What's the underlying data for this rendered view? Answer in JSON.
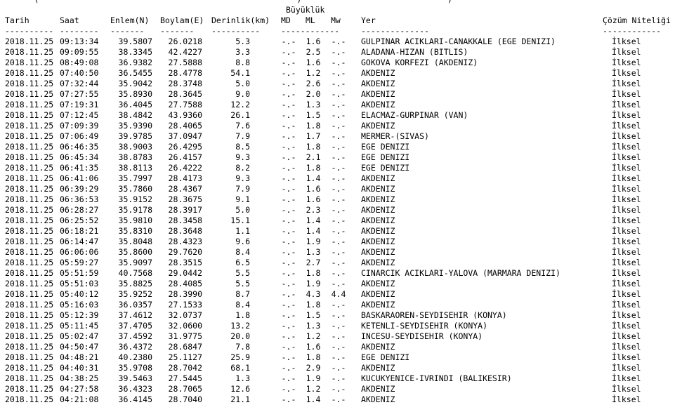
{
  "top_partial": "      (                                                     )                              )",
  "group_header": "Büyüklük",
  "headers": {
    "date": "Tarih",
    "time": "Saat",
    "lat": "Enlem(N)",
    "lon": "Boylam(E)",
    "depth": "Derinlik(km)",
    "md": "MD",
    "ml": "ML",
    "mw": "Mw",
    "location": "Yer",
    "solution": "Çözüm Niteliği"
  },
  "dashes": {
    "date": "----------",
    "time": "--------",
    "lat": "-------",
    "lon": "-------",
    "depth": "----------",
    "mag": "------------",
    "location": "--------------",
    "solution": "------------"
  },
  "rows": [
    [
      "2018.11.25",
      "09:13:34",
      "39.5807",
      "26.0218",
      "5.3",
      "-.-",
      "1.6",
      "-.-",
      "GULPINAR ACIKLARI-CANAKKALE (EGE DENIZI)",
      "İlksel"
    ],
    [
      "2018.11.25",
      "09:09:55",
      "38.3345",
      "42.4227",
      "3.3",
      "-.-",
      "2.5",
      "-.-",
      "ALADANA-HIZAN (BITLIS)",
      "İlksel"
    ],
    [
      "2018.11.25",
      "08:49:08",
      "36.9382",
      "27.5888",
      "8.8",
      "-.-",
      "1.6",
      "-.-",
      "GOKOVA KORFEZI (AKDENIZ)",
      "İlksel"
    ],
    [
      "2018.11.25",
      "07:40:50",
      "36.5455",
      "28.4778",
      "54.1",
      "-.-",
      "1.2",
      "-.-",
      "AKDENIZ",
      "İlksel"
    ],
    [
      "2018.11.25",
      "07:32:44",
      "35.9042",
      "28.3748",
      "5.0",
      "-.-",
      "2.6",
      "-.-",
      "AKDENIZ",
      "İlksel"
    ],
    [
      "2018.11.25",
      "07:27:55",
      "35.8930",
      "28.3645",
      "9.0",
      "-.-",
      "2.0",
      "-.-",
      "AKDENIZ",
      "İlksel"
    ],
    [
      "2018.11.25",
      "07:19:31",
      "36.4045",
      "27.7588",
      "12.2",
      "-.-",
      "1.3",
      "-.-",
      "AKDENIZ",
      "İlksel"
    ],
    [
      "2018.11.25",
      "07:12:45",
      "38.4842",
      "43.9360",
      "26.1",
      "-.-",
      "1.5",
      "-.-",
      "ELACMAZ-GURPINAR (VAN)",
      "İlksel"
    ],
    [
      "2018.11.25",
      "07:09:39",
      "35.9390",
      "28.4065",
      "7.6",
      "-.-",
      "1.8",
      "-.-",
      "AKDENIZ",
      "İlksel"
    ],
    [
      "2018.11.25",
      "07:06:49",
      "39.9785",
      "37.0947",
      "7.9",
      "-.-",
      "1.7",
      "-.-",
      "MERMER-(SIVAS)",
      "İlksel"
    ],
    [
      "2018.11.25",
      "06:46:35",
      "38.9003",
      "26.4295",
      "8.5",
      "-.-",
      "1.8",
      "-.-",
      "EGE DENIZI",
      "İlksel"
    ],
    [
      "2018.11.25",
      "06:45:34",
      "38.8783",
      "26.4157",
      "9.3",
      "-.-",
      "2.1",
      "-.-",
      "EGE DENIZI",
      "İlksel"
    ],
    [
      "2018.11.25",
      "06:41:35",
      "38.8113",
      "26.4222",
      "8.2",
      "-.-",
      "1.8",
      "-.-",
      "EGE DENIZI",
      "İlksel"
    ],
    [
      "2018.11.25",
      "06:41:06",
      "35.7997",
      "28.4173",
      "9.3",
      "-.-",
      "1.4",
      "-.-",
      "AKDENIZ",
      "İlksel"
    ],
    [
      "2018.11.25",
      "06:39:29",
      "35.7860",
      "28.4367",
      "7.9",
      "-.-",
      "1.6",
      "-.-",
      "AKDENIZ",
      "İlksel"
    ],
    [
      "2018.11.25",
      "06:36:53",
      "35.9152",
      "28.3675",
      "9.1",
      "-.-",
      "1.6",
      "-.-",
      "AKDENIZ",
      "İlksel"
    ],
    [
      "2018.11.25",
      "06:28:27",
      "35.9178",
      "28.3917",
      "5.0",
      "-.-",
      "2.3",
      "-.-",
      "AKDENIZ",
      "İlksel"
    ],
    [
      "2018.11.25",
      "06:25:52",
      "35.9810",
      "28.3458",
      "15.1",
      "-.-",
      "1.4",
      "-.-",
      "AKDENIZ",
      "İlksel"
    ],
    [
      "2018.11.25",
      "06:18:21",
      "35.8310",
      "28.3648",
      "1.1",
      "-.-",
      "1.4",
      "-.-",
      "AKDENIZ",
      "İlksel"
    ],
    [
      "2018.11.25",
      "06:14:47",
      "35.8048",
      "28.4323",
      "9.6",
      "-.-",
      "1.9",
      "-.-",
      "AKDENIZ",
      "İlksel"
    ],
    [
      "2018.11.25",
      "06:06:06",
      "35.8600",
      "29.7620",
      "8.4",
      "-.-",
      "1.3",
      "-.-",
      "AKDENIZ",
      "İlksel"
    ],
    [
      "2018.11.25",
      "05:59:27",
      "35.9097",
      "28.3515",
      "6.5",
      "-.-",
      "2.7",
      "-.-",
      "AKDENIZ",
      "İlksel"
    ],
    [
      "2018.11.25",
      "05:51:59",
      "40.7568",
      "29.0442",
      "5.5",
      "-.-",
      "1.8",
      "-.-",
      "CINARCIK ACIKLARI-YALOVA (MARMARA DENIZI)",
      "İlksel"
    ],
    [
      "2018.11.25",
      "05:51:03",
      "35.8825",
      "28.4085",
      "5.5",
      "-.-",
      "1.9",
      "-.-",
      "AKDENIZ",
      "İlksel"
    ],
    [
      "2018.11.25",
      "05:40:12",
      "35.9252",
      "28.3990",
      "8.7",
      "-.-",
      "4.3",
      "4.4",
      "AKDENIZ",
      "İlksel"
    ],
    [
      "2018.11.25",
      "05:16:03",
      "36.0357",
      "27.1533",
      "8.4",
      "-.-",
      "1.8",
      "-.-",
      "AKDENIZ",
      "İlksel"
    ],
    [
      "2018.11.25",
      "05:12:39",
      "37.4612",
      "32.0737",
      "1.8",
      "-.-",
      "1.5",
      "-.-",
      "BASKARAOREN-SEYDISEHIR (KONYA)",
      "İlksel"
    ],
    [
      "2018.11.25",
      "05:11:45",
      "37.4705",
      "32.0600",
      "13.2",
      "-.-",
      "1.3",
      "-.-",
      "KETENLI-SEYDISEHIR (KONYA)",
      "İlksel"
    ],
    [
      "2018.11.25",
      "05:02:47",
      "37.4592",
      "31.9775",
      "20.0",
      "-.-",
      "1.2",
      "-.-",
      "INCESU-SEYDISEHIR (KONYA)",
      "İlksel"
    ],
    [
      "2018.11.25",
      "04:50:47",
      "36.4372",
      "28.6847",
      "7.8",
      "-.-",
      "1.6",
      "-.-",
      "AKDENIZ",
      "İlksel"
    ],
    [
      "2018.11.25",
      "04:48:21",
      "40.2380",
      "25.1127",
      "25.9",
      "-.-",
      "1.8",
      "-.-",
      "EGE DENIZI",
      "İlksel"
    ],
    [
      "2018.11.25",
      "04:40:31",
      "35.9708",
      "28.7042",
      "68.1",
      "-.-",
      "2.9",
      "-.-",
      "AKDENIZ",
      "İlksel"
    ],
    [
      "2018.11.25",
      "04:38:25",
      "39.5463",
      "27.5445",
      "1.3",
      "-.-",
      "1.9",
      "-.-",
      "KUCUKYENICE-IVRINDI (BALIKESIR)",
      "İlksel"
    ],
    [
      "2018.11.25",
      "04:27:58",
      "36.4323",
      "28.7065",
      "12.6",
      "-.-",
      "1.2",
      "-.-",
      "AKDENIZ",
      "İlksel"
    ],
    [
      "2018.11.25",
      "04:21:08",
      "36.4145",
      "28.7040",
      "21.1",
      "-.-",
      "1.4",
      "-.-",
      "AKDENIZ",
      "İlksel"
    ]
  ]
}
